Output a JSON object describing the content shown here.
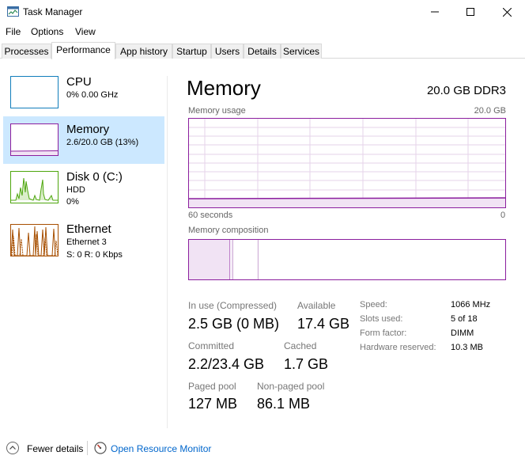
{
  "window": {
    "title": "Task Manager",
    "icons": [
      "app-icon",
      "minimize-icon",
      "maximize-icon",
      "close-icon"
    ]
  },
  "menu": [
    "File",
    "Options",
    "View"
  ],
  "tabs": [
    "Processes",
    "Performance",
    "App history",
    "Startup",
    "Users",
    "Details",
    "Services"
  ],
  "active_tab": "Performance",
  "sidebar": {
    "items": [
      {
        "name": "CPU",
        "line1": "0%  0.00 GHz",
        "line2": "",
        "color": "#117dbb"
      },
      {
        "name": "Memory",
        "line1": "2.6/20.0 GB (13%)",
        "line2": "",
        "color": "#8b1e9e"
      },
      {
        "name": "Disk 0 (C:)",
        "line1": "HDD",
        "line2": "0%",
        "color": "#4da60c"
      },
      {
        "name": "Ethernet",
        "line1": "Ethernet 3",
        "line2": "S: 0  R: 0 Kbps",
        "color": "#a74f01"
      }
    ]
  },
  "main": {
    "title": "Memory",
    "capacity": "20.0 GB DDR3",
    "usage_chart": {
      "label": "Memory usage",
      "max_label": "20.0 GB",
      "x_left": "60 seconds",
      "x_right": "0",
      "fill_fraction": 0.13
    },
    "composition": {
      "label": "Memory composition",
      "in_use_fraction": 0.13,
      "modified_fraction": 0.0085,
      "standby_fraction": 0.08
    },
    "stats": {
      "in_use_label": "In use (Compressed)",
      "in_use_value": "2.5 GB (0 MB)",
      "available_label": "Available",
      "available_value": "17.4 GB",
      "committed_label": "Committed",
      "committed_value": "2.2/23.4 GB",
      "cached_label": "Cached",
      "cached_value": "1.7 GB",
      "paged_label": "Paged pool",
      "paged_value": "127 MB",
      "nonpaged_label": "Non-paged pool",
      "nonpaged_value": "86.1 MB"
    },
    "specs": [
      {
        "label": "Speed:",
        "value": "1066 MHz"
      },
      {
        "label": "Slots used:",
        "value": "5 of 18"
      },
      {
        "label": "Form factor:",
        "value": "DIMM"
      },
      {
        "label": "Hardware reserved:",
        "value": "10.3 MB"
      }
    ]
  },
  "footer": {
    "fewer_details": "Fewer details",
    "open_monitor": "Open Resource Monitor"
  },
  "colors": {
    "accent_memory": "#8b1e9e",
    "selected_bg": "#cce8ff",
    "link": "#0066cc"
  }
}
